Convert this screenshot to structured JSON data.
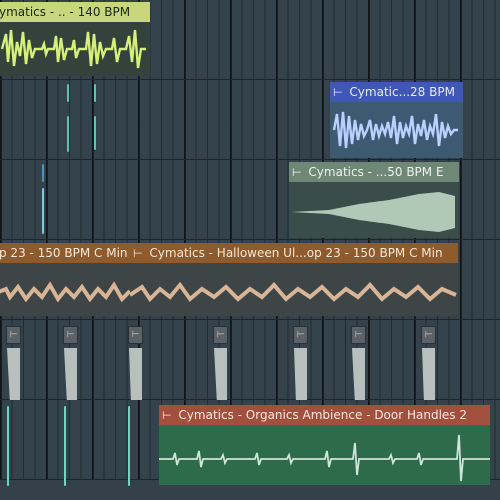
{
  "playlist": {
    "clips": [
      {
        "label": "ymatics - .. - 140 BPM",
        "icon": "arrow-right-bar-icon"
      },
      {
        "label": "Cymatic...28 BPM",
        "icon": "arrow-right-bar-icon"
      },
      {
        "label": "Cymatics - ...50 BPM E",
        "icon": "arrow-right-bar-icon"
      },
      {
        "label": "p 23 - 150 BPM C Min",
        "icon": "none"
      },
      {
        "label": "Cymatics - Halloween Ul...op 23 - 150 BPM C Min",
        "icon": "arrow-right-bar-icon"
      },
      {
        "label": "Cymatics - Organics Ambience - Door Handles 2",
        "icon": "arrow-right-bar-icon"
      }
    ],
    "slice_marker_glyph": "⊢",
    "arrow_glyph": "⊢"
  },
  "colors": {
    "background": "#34414a",
    "clip_yellow": "#c9d77c",
    "clip_blue": "#3f58b3",
    "clip_sage": "#6f8775",
    "clip_brown": "#8f5a2c",
    "clip_red": "#a34f3e",
    "wave_teal": "#6fd6c2",
    "wave_gray": "#b9bfbd"
  }
}
